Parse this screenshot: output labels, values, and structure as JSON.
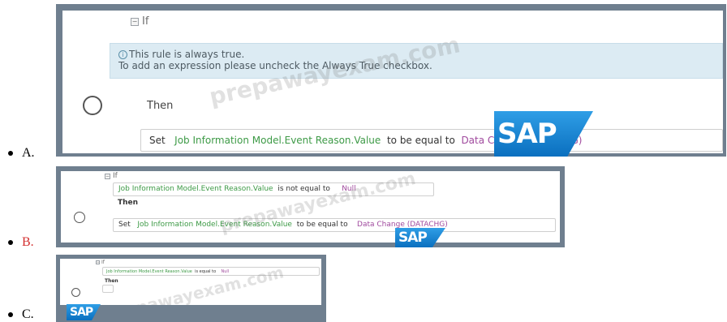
{
  "options": [
    {
      "label": "A.",
      "selected": false,
      "if_label": "If",
      "banner_line1": "This rule is always true.",
      "banner_line2": "To add an expression please uncheck the Always True checkbox.",
      "then_label": "Then",
      "set_label": "Set",
      "set_target": "Job Information Model.Event Reason.Value",
      "to_be_label": "to be equal to",
      "set_value": "Data Change (DATACHG)"
    },
    {
      "label": "B.",
      "selected": true,
      "if_label": "If",
      "condition_field": "Job Information Model.Event Reason.Value",
      "condition_operator": "is not equal to",
      "condition_value": "Null",
      "then_label": "Then",
      "set_label": "Set",
      "set_target": "Job Information Model.Event Reason.Value",
      "to_be_label": "to be equal to",
      "set_value": "Data Change (DATACHG)"
    },
    {
      "label": "C.",
      "selected": false,
      "if_label": "If",
      "condition_field": "Job Information Model.Event Reason.Value",
      "condition_operator": "is equal to",
      "condition_value": "Null",
      "then_label": "Then"
    }
  ],
  "logo_text": "SAP",
  "watermark_text": "prepawayexam.com",
  "colors": {
    "frame": "#6f7f8f",
    "field_green": "#3d9a46",
    "value_purple": "#a04a9e",
    "selected_label": "#d32f2f",
    "sap_blue": "#0a6fbf"
  }
}
